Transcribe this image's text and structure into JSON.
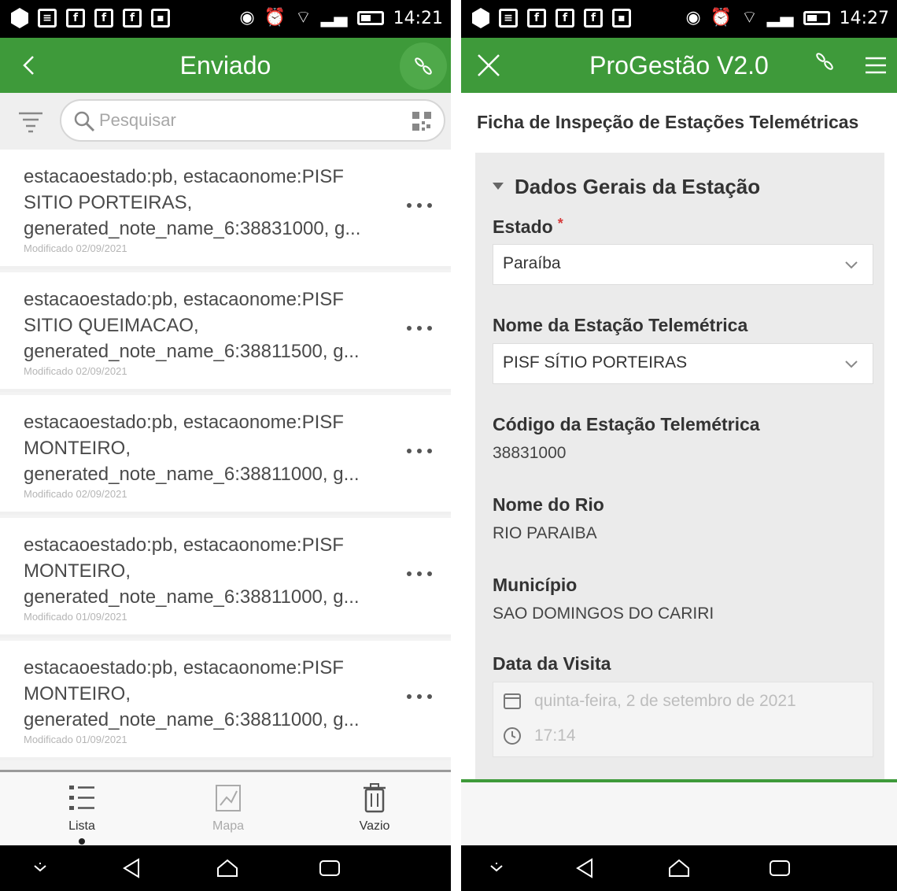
{
  "left": {
    "status": {
      "time": "14:21"
    },
    "header": {
      "title": "Enviado"
    },
    "search": {
      "placeholder": "Pesquisar"
    },
    "items": [
      {
        "line1": "estacaoestado:pb, estacaonome:PISF",
        "line2": "SITIO PORTEIRAS,",
        "line3": "generated_note_name_6:38831000, g...",
        "modified": "Modificado 02/09/2021"
      },
      {
        "line1": "estacaoestado:pb, estacaonome:PISF",
        "line2": "SITIO QUEIMACAO,",
        "line3": "generated_note_name_6:38811500, g...",
        "modified": "Modificado 02/09/2021"
      },
      {
        "line1": "estacaoestado:pb, estacaonome:PISF",
        "line2": "MONTEIRO,",
        "line3": "generated_note_name_6:38811000, g...",
        "modified": "Modificado 02/09/2021"
      },
      {
        "line1": "estacaoestado:pb, estacaonome:PISF",
        "line2": "MONTEIRO,",
        "line3": "generated_note_name_6:38811000, g...",
        "modified": "Modificado 01/09/2021"
      },
      {
        "line1": "estacaoestado:pb, estacaonome:PISF",
        "line2": "MONTEIRO,",
        "line3": "generated_note_name_6:38811000, g...",
        "modified": "Modificado 01/09/2021"
      }
    ],
    "tabs": [
      {
        "label": "Lista",
        "active": true
      },
      {
        "label": "Mapa",
        "active": false
      },
      {
        "label": "Vazio",
        "active": false
      }
    ]
  },
  "right": {
    "status": {
      "time": "14:27"
    },
    "header": {
      "title": "ProGestão V2.0"
    },
    "form_title": "Ficha de Inspeção de Estações Telemétricas",
    "section_title": "Dados Gerais da Estação",
    "fields": {
      "estado": {
        "label": "Estado",
        "required_mark": "*",
        "value": "Paraíba"
      },
      "nome_estacao": {
        "label": "Nome da Estação Telemétrica",
        "value": "PISF SÍTIO PORTEIRAS"
      },
      "codigo": {
        "label": "Código da Estação Telemétrica",
        "value": "38831000"
      },
      "rio": {
        "label": "Nome do Rio",
        "value": "RIO PARAIBA"
      },
      "municipio": {
        "label": "Município",
        "value": "SAO DOMINGOS DO CARIRI"
      },
      "data_visita": {
        "label": "Data da Visita",
        "date": "quinta-feira, 2 de setembro de 2021",
        "time": "17:14"
      }
    }
  },
  "colors": {
    "app_green": "#3e9a3a",
    "status_black": "#000000",
    "required_red": "#d63a3a"
  }
}
